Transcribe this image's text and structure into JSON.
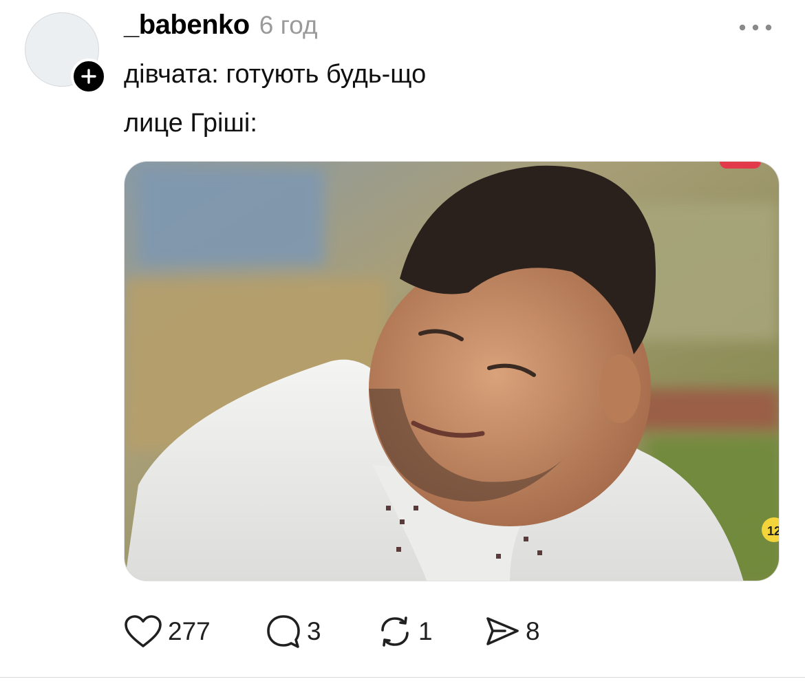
{
  "post": {
    "username": "_babenko",
    "time": "6 год",
    "text_lines": [
      "дівчата: готують будь-що",
      "лице Гріші:"
    ],
    "media": {
      "description_icon": "photo",
      "channel_badge": "12"
    },
    "actions": {
      "like": {
        "icon": "heart-icon",
        "count": "277"
      },
      "reply": {
        "icon": "comment-icon",
        "count": "3"
      },
      "repost": {
        "icon": "repost-icon",
        "count": "1"
      },
      "share": {
        "icon": "send-icon",
        "count": "8"
      }
    }
  },
  "colors": {
    "text": "#101010",
    "muted": "#9a9a9a",
    "divider": "#dadada",
    "follow_badge": "#000000"
  }
}
